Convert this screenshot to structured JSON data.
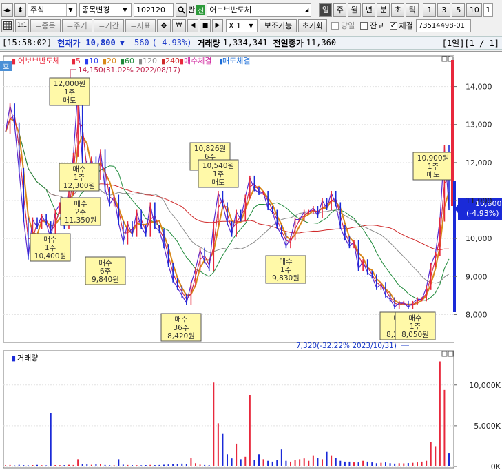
{
  "toolbar": {
    "market_select": "주식",
    "change_code_select": "종목변경",
    "code_input": "102120",
    "relation_label": "관",
    "credit_badge": "신",
    "stock_name": "어보브반도체",
    "periods": [
      "일",
      "주",
      "월",
      "년",
      "분",
      "초",
      "틱"
    ],
    "period_active": "일",
    "minute_numbers": [
      "1",
      "3",
      "5",
      "10",
      "1"
    ]
  },
  "toolbar2": {
    "ratio_label": "1:1",
    "add_stock": "=종목",
    "add_period": "=주기",
    "add_range": "=기간",
    "add_indicator": "=지표",
    "multiplier": "X 1",
    "aux_function": "보조기능",
    "reset": "초기화",
    "today_label": "당일",
    "today_checked": false,
    "balance_label": "잔고",
    "balance_checked": false,
    "execution_label": "체결",
    "execution_checked": true,
    "account_number": "73514498-01"
  },
  "infobar": {
    "time": "[15:58:02]",
    "current_label": "현재가",
    "current_price": "10,800",
    "direction": "▼",
    "change": "560",
    "change_pct": "(-4.93%)",
    "volume_label": "거래량",
    "volume": "1,334,341",
    "prev_close_label": "전일종가",
    "prev_close": "11,360",
    "page": "[1일][1 / 1]"
  },
  "price_panel": {
    "side_tag": "호",
    "legend_title": "어보브반도체",
    "ma_legend": [
      {
        "label": "5",
        "color": "#e8283c"
      },
      {
        "label": "10",
        "color": "#2a3cf0"
      },
      {
        "label": "20",
        "color": "#d8881a"
      },
      {
        "label": "60",
        "color": "#1e8a3a"
      },
      {
        "label": "120",
        "color": "#8a8a8a"
      },
      {
        "label": "240",
        "color": "#d02a2a"
      }
    ],
    "buy_exec_label": "매수체결",
    "sell_exec_label": "매도체결",
    "high_note": "14,150(31.02% 2022/08/17)",
    "low_note": "7,320(-32.22% 2023/10/31)",
    "current_tag_price": "10,800",
    "current_tag_pct": "(-4.93%)"
  },
  "chart_data": [
    {
      "type": "line",
      "series": [
        {
          "name": "어보브반도체"
        },
        {
          "name": "5"
        },
        {
          "name": "10"
        },
        {
          "name": "20"
        },
        {
          "name": "60"
        },
        {
          "name": "120"
        },
        {
          "name": "240"
        }
      ],
      "ylabels": [
        "14,000",
        "13,000",
        "12,000",
        "11,000",
        "10,000",
        "9,000",
        "8,000"
      ],
      "yticks": [
        14000,
        13000,
        12000,
        11000,
        10000,
        9000,
        8000
      ],
      "ylim": [
        7300,
        14700
      ],
      "close_points": [
        12800,
        13500,
        13000,
        11800,
        10500,
        9500,
        10500,
        10300,
        10600,
        10400,
        10000,
        10700,
        10900,
        10300,
        11200,
        12200,
        13900,
        12000,
        11600,
        12100,
        11600,
        12300,
        11300,
        10900,
        11100,
        10400,
        9900,
        10400,
        10100,
        10700,
        10300,
        10100,
        10900,
        10300,
        10200,
        9800,
        9300,
        8900,
        8700,
        8500,
        8300,
        8800,
        9200,
        9700,
        9400,
        9200,
        10400,
        11200,
        10900,
        10400,
        10100,
        10700,
        10500,
        11100,
        11600,
        11300,
        11200,
        11200,
        10800,
        10700,
        10300,
        10100,
        9800,
        10000,
        10500,
        10500,
        10700,
        10700,
        10800,
        10600,
        11000,
        10800,
        11200,
        10900,
        10300,
        10000,
        9800,
        9900,
        9200,
        9400,
        9100,
        9000,
        8700,
        8800,
        8500,
        8400,
        8200,
        8300,
        8300,
        8200,
        8300,
        8400,
        8400,
        8700,
        9300,
        9600,
        10500,
        12400,
        10800
      ],
      "trades": [
        {
          "price": "12,000원",
          "qty": "1주",
          "side": "매도"
        },
        {
          "price": "12,300원",
          "qty": "1주",
          "side": "매수"
        },
        {
          "price": "11,350원",
          "qty": "2주",
          "side": "매수"
        },
        {
          "price": "10,400원",
          "qty": "1주",
          "side": "매수"
        },
        {
          "price": "9,840원",
          "qty": "6주",
          "side": "매수"
        },
        {
          "price": "8,420원",
          "qty": "36주",
          "side": "매수"
        },
        {
          "price": "10,826원",
          "qty": "6주",
          "side": "매도"
        },
        {
          "price": "10,540원",
          "qty": "1주",
          "side": "매도"
        },
        {
          "price": "9,830원",
          "qty": "1주",
          "side": "매수"
        },
        {
          "price": "8,230원",
          "qty": "3주",
          "side": "매수"
        },
        {
          "price": "8,050원",
          "qty": "1주",
          "side": "매수"
        },
        {
          "price": "10,900원",
          "qty": "1주",
          "side": "매도"
        }
      ]
    },
    {
      "type": "bar",
      "series": [
        {
          "name": "거래량"
        }
      ],
      "ylabels": [
        "10,000K",
        "5,000K",
        "0K"
      ],
      "yticks": [
        10000,
        5000,
        0
      ],
      "ylim": [
        0,
        13700
      ],
      "values": [
        150,
        180,
        120,
        200,
        160,
        140,
        170,
        190,
        150,
        130,
        6600,
        170,
        150,
        160,
        200,
        180,
        900,
        300,
        250,
        200,
        260,
        300,
        180,
        150,
        140,
        900,
        220,
        180,
        160,
        150,
        140,
        170,
        190,
        160,
        180,
        210,
        240,
        260,
        300,
        350,
        260,
        1100,
        400,
        220,
        180,
        160,
        10300,
        5300,
        4000,
        1500,
        1000,
        2800,
        900,
        1200,
        8800,
        800,
        1500,
        900,
        700,
        600,
        800,
        2100,
        700,
        600,
        800,
        900,
        1000,
        700,
        1300,
        1100,
        900,
        1800,
        1300,
        1100,
        700,
        600,
        600,
        500,
        500,
        700,
        600,
        500,
        400,
        450,
        500,
        400,
        350,
        400,
        380,
        420,
        450,
        500,
        600,
        700,
        3000,
        2500,
        12900,
        9400,
        1600
      ],
      "legend_label": "거래량"
    }
  ]
}
